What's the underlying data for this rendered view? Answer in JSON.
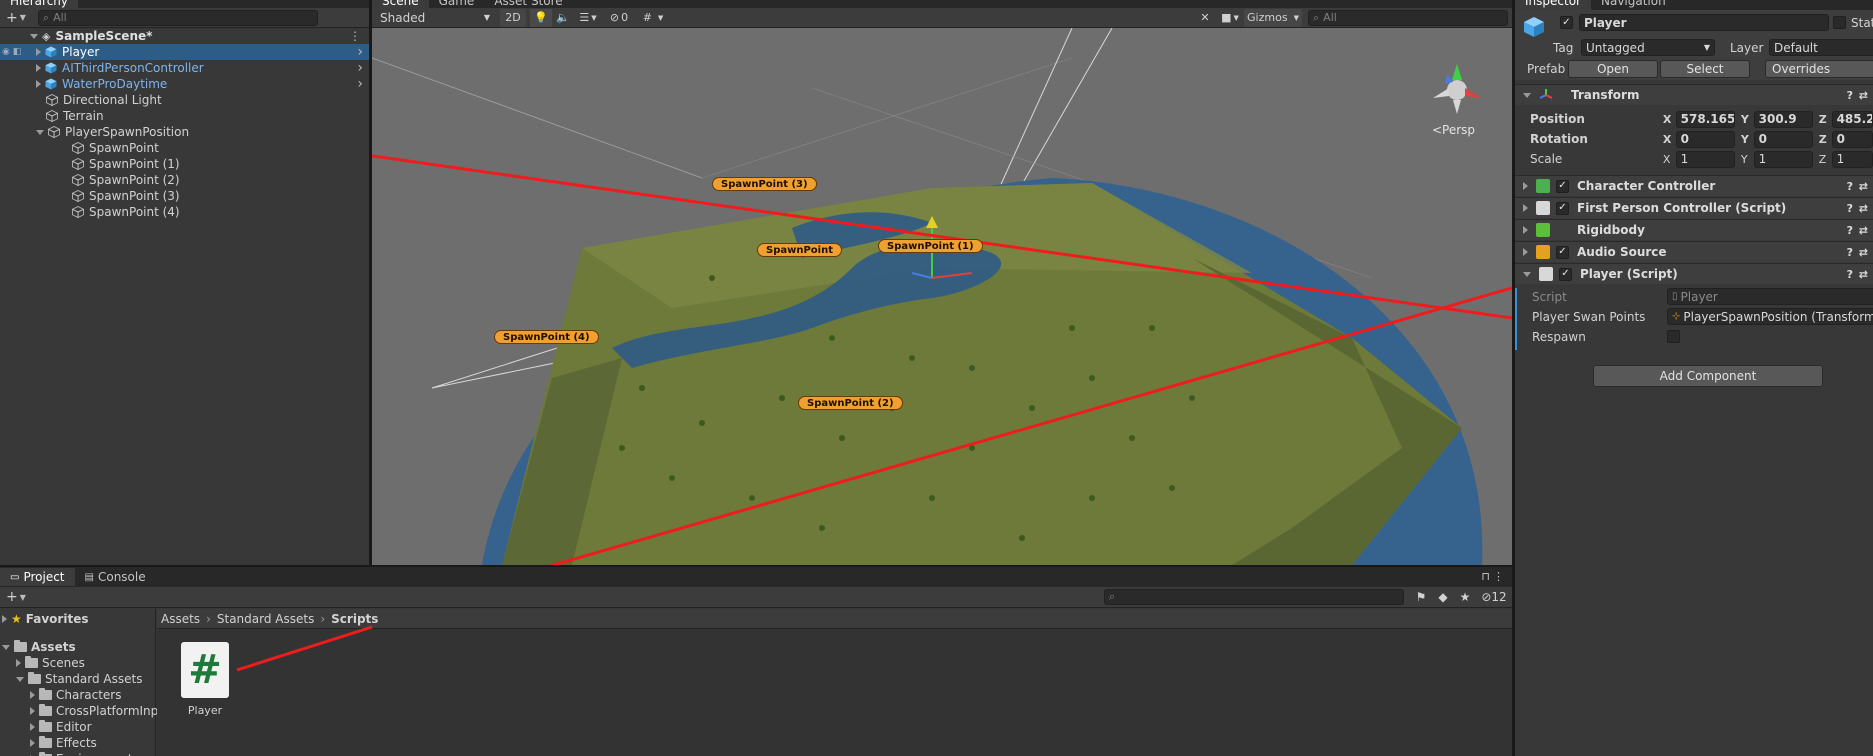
{
  "hierarchy": {
    "tab_label": "Hierarchy",
    "search_placeholder": "All",
    "scene": "SampleScene*",
    "items": [
      {
        "label": "Player",
        "selected": true,
        "blue": true,
        "expandable": true
      },
      {
        "label": "AIThirdPersonController",
        "blue": true,
        "expandable": true
      },
      {
        "label": "WaterProDaytime",
        "blue": true,
        "expandable": true
      },
      {
        "label": "Directional Light"
      },
      {
        "label": "Terrain"
      },
      {
        "label": "PlayerSpawnPosition",
        "expanded": true
      },
      {
        "label": "SpawnPoint",
        "child": true
      },
      {
        "label": "SpawnPoint (1)",
        "child": true
      },
      {
        "label": "SpawnPoint (2)",
        "child": true
      },
      {
        "label": "SpawnPoint (3)",
        "child": true
      },
      {
        "label": "SpawnPoint (4)",
        "child": true
      }
    ]
  },
  "scene_view": {
    "tabs": [
      "Scene",
      "Game",
      "Asset Store"
    ],
    "shading": "Shaded",
    "mode_2d": "2D",
    "hidden_count": "0",
    "gizmos": "Gizmos",
    "search_placeholder": "All",
    "persp_label": "<Persp",
    "spawn_labels": [
      "SpawnPoint (3)",
      "SpawnPoint",
      "SpawnPoint (1)",
      "SpawnPoint (4)",
      "SpawnPoint (2)"
    ]
  },
  "inspector": {
    "tabs": [
      "Inspector",
      "Navigation"
    ],
    "object_name": "Player",
    "static_label": "Stat",
    "tag_label": "Tag",
    "tag_value": "Untagged",
    "layer_label": "Layer",
    "layer_value": "Default",
    "prefab_label": "Prefab",
    "prefab_open": "Open",
    "prefab_select": "Select",
    "prefab_overrides": "Overrides",
    "transform": {
      "title": "Transform",
      "position_label": "Position",
      "rotation_label": "Rotation",
      "scale_label": "Scale",
      "position": {
        "x": "578.165",
        "y": "300.9",
        "z": "485.2"
      },
      "rotation": {
        "x": "0",
        "y": "0",
        "z": "0"
      },
      "scale": {
        "x": "1",
        "y": "1",
        "z": "1"
      }
    },
    "components": [
      {
        "title": "Character Controller",
        "checkbox": true,
        "icon_color": "#4caf50"
      },
      {
        "title": "First Person Controller (Script)",
        "checkbox": true,
        "icon_color": "#d8d8d8"
      },
      {
        "title": "Rigidbody",
        "checkbox": false,
        "icon_color": "#5cbf3a"
      },
      {
        "title": "Audio Source",
        "checkbox": true,
        "icon_color": "#e6a020"
      },
      {
        "title": "Player (Script)",
        "checkbox": true,
        "icon_color": "#d8d8d8"
      }
    ],
    "player_script": {
      "script_label": "Script",
      "script_value": "Player",
      "spawn_label": "Player Swan Points",
      "spawn_value": "PlayerSpawnPosition (Transform)",
      "respawn_label": "Respawn"
    },
    "add_component": "Add Component"
  },
  "project": {
    "tabs": [
      "Project",
      "Console"
    ],
    "hidden_count": "12",
    "breadcrumb": [
      "Assets",
      "Standard Assets",
      "Scripts"
    ],
    "favorites": "Favorites",
    "tree": [
      {
        "label": "Assets",
        "level": 0,
        "bold": true,
        "expanded": true
      },
      {
        "label": "Scenes",
        "level": 1
      },
      {
        "label": "Standard Assets",
        "level": 1,
        "expanded": true
      },
      {
        "label": "Characters",
        "level": 2
      },
      {
        "label": "CrossPlatformInput",
        "level": 2
      },
      {
        "label": "Editor",
        "level": 2
      },
      {
        "label": "Effects",
        "level": 2
      },
      {
        "label": "Environment",
        "level": 2
      }
    ],
    "asset_label": "Player",
    "asset_symbol": "#"
  }
}
